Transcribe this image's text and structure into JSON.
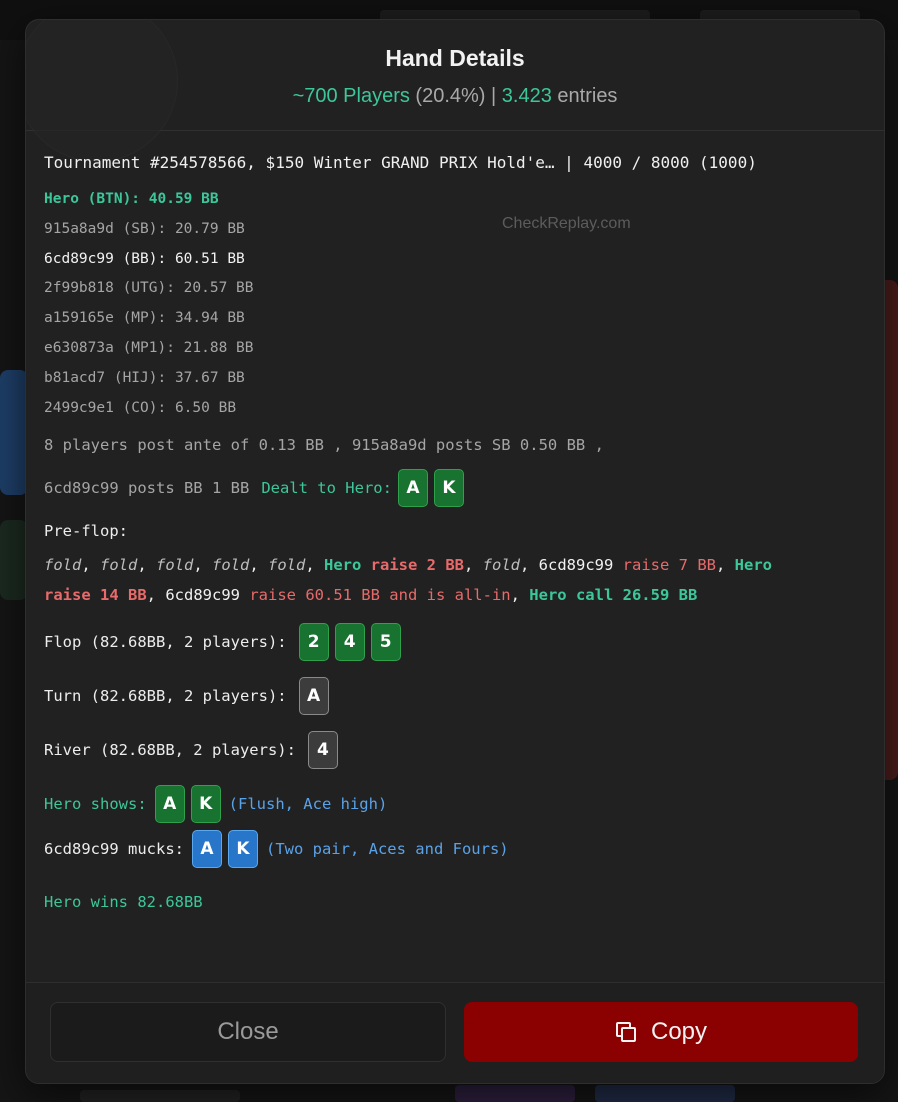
{
  "header": {
    "title": "Hand Details",
    "players_count": "~700 Players",
    "players_pct": "(20.4%)",
    "separator": "|",
    "entries_count": "3.423",
    "entries_label": "entries"
  },
  "tournament_line": "Tournament #254578566, $150 Winter GRAND PRIX Hold'e… | 4000 / 8000 (1000)",
  "watermark": "CheckReplay.com",
  "players": [
    {
      "text": "Hero (BTN): 40.59 BB"
    },
    {
      "text": "915a8a9d (SB): 20.79 BB"
    },
    {
      "text": "6cd89c99 (BB): 60.51 BB"
    },
    {
      "text": "2f99b818 (UTG): 20.57 BB"
    },
    {
      "text": "a159165e (MP): 34.94 BB"
    },
    {
      "text": "e630873a (MP1): 21.88 BB"
    },
    {
      "text": "b81acd7 (HIJ): 37.67 BB"
    },
    {
      "text": "2499c9e1 (CO): 6.50 BB"
    }
  ],
  "posts": {
    "line1": "8 players post ante of 0.13 BB , 915a8a9d posts SB 0.50 BB ,",
    "line2": "6cd89c99 posts BB 1 BB",
    "dealt_label": "Dealt to Hero:",
    "hero_cards": [
      "A",
      "K"
    ]
  },
  "preflop": {
    "label": "Pre-flop:",
    "fold": "fold",
    "sep": ", ",
    "hero": "Hero",
    "hero_raise": "raise 2 BB",
    "villain": "6cd89c99",
    "villain_raise": "raise 7 BB",
    "hero_raise2": "raise 14 BB",
    "villain_allin": "raise 60.51 BB and is all-in",
    "hero_call": "call 26.59 BB"
  },
  "flop": {
    "label": "Flop (82.68BB, 2 players):",
    "cards": [
      "2",
      "4",
      "5"
    ]
  },
  "turn": {
    "label": "Turn (82.68BB, 2 players):",
    "cards": [
      "A"
    ]
  },
  "river": {
    "label": "River (82.68BB, 2 players):",
    "cards": [
      "4"
    ]
  },
  "showdown": {
    "hero_label": "Hero shows:",
    "hero_cards": [
      "A",
      "K"
    ],
    "hero_hand": "(Flush, Ace high)",
    "villain_label": "6cd89c99 mucks:",
    "villain_cards": [
      "A",
      "K"
    ],
    "villain_hand": "(Two pair, Aces and Fours)"
  },
  "result": "Hero wins 82.68BB",
  "footer": {
    "close_label": "Close",
    "copy_label": "Copy"
  },
  "colors": {
    "accent_green": "#3cc79a",
    "raise_red": "#e86a6a",
    "copy_button": "#8b0000",
    "board_card": "#17732f",
    "villain_card": "#2776c9"
  },
  "icons": {
    "copy": "copy-icon"
  }
}
